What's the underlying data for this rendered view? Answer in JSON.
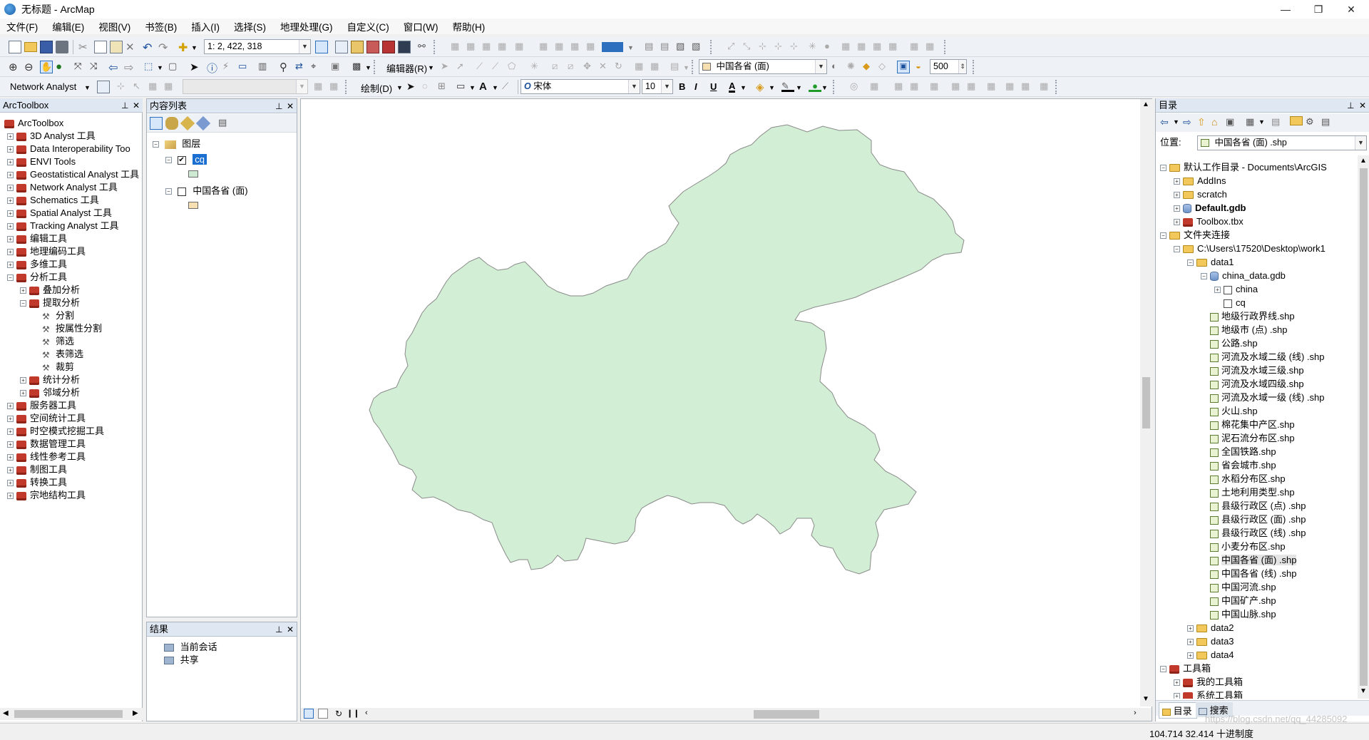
{
  "window": {
    "title": "无标题 - ArcMap",
    "min": "—",
    "restore": "❐",
    "close": "✕"
  },
  "menu": [
    "文件(F)",
    "编辑(E)",
    "视图(V)",
    "书签(B)",
    "插入(I)",
    "选择(S)",
    "地理处理(G)",
    "自定义(C)",
    "窗口(W)",
    "帮助(H)"
  ],
  "toolbar1": {
    "scale": "1: 2, 422, 318"
  },
  "toolbar2": {
    "editor_label": "编辑器(R)",
    "layer_combo": "中国各省 (面)",
    "ref_value": "500"
  },
  "toolbar3": {
    "network_analyst": "Network Analyst",
    "draw_label": "绘制(D)",
    "font_name": "宋体",
    "font_size": "10",
    "bold": "B",
    "italic": "I",
    "underline": "U",
    "font_color": "A"
  },
  "arctoolbox": {
    "title": "ArcToolbox",
    "root": "ArcToolbox",
    "items": [
      {
        "label": "3D Analyst 工具",
        "level": 0,
        "exp": "+"
      },
      {
        "label": "Data Interoperability Too",
        "level": 0,
        "exp": "+"
      },
      {
        "label": "ENVI Tools",
        "level": 0,
        "exp": "+"
      },
      {
        "label": "Geostatistical Analyst 工具",
        "level": 0,
        "exp": "+"
      },
      {
        "label": "Network Analyst 工具",
        "level": 0,
        "exp": "+"
      },
      {
        "label": "Schematics 工具",
        "level": 0,
        "exp": "+"
      },
      {
        "label": "Spatial Analyst 工具",
        "level": 0,
        "exp": "+"
      },
      {
        "label": "Tracking Analyst 工具",
        "level": 0,
        "exp": "+"
      },
      {
        "label": "编辑工具",
        "level": 0,
        "exp": "+"
      },
      {
        "label": "地理编码工具",
        "level": 0,
        "exp": "+"
      },
      {
        "label": "多维工具",
        "level": 0,
        "exp": "+"
      },
      {
        "label": "分析工具",
        "level": 0,
        "exp": "−"
      },
      {
        "label": "叠加分析",
        "level": 1,
        "exp": "+"
      },
      {
        "label": "提取分析",
        "level": 1,
        "exp": "−"
      },
      {
        "label": "分割",
        "level": 2,
        "exp": "",
        "tool": true
      },
      {
        "label": "按属性分割",
        "level": 2,
        "exp": "",
        "tool": true
      },
      {
        "label": "筛选",
        "level": 2,
        "exp": "",
        "tool": true
      },
      {
        "label": "表筛选",
        "level": 2,
        "exp": "",
        "tool": true
      },
      {
        "label": "裁剪",
        "level": 2,
        "exp": "",
        "tool": true
      },
      {
        "label": "统计分析",
        "level": 1,
        "exp": "+"
      },
      {
        "label": "邻域分析",
        "level": 1,
        "exp": "+"
      },
      {
        "label": "服务器工具",
        "level": 0,
        "exp": "+"
      },
      {
        "label": "空间统计工具",
        "level": 0,
        "exp": "+"
      },
      {
        "label": "时空模式挖掘工具",
        "level": 0,
        "exp": "+"
      },
      {
        "label": "数据管理工具",
        "level": 0,
        "exp": "+"
      },
      {
        "label": "线性参考工具",
        "level": 0,
        "exp": "+"
      },
      {
        "label": "制图工具",
        "level": 0,
        "exp": "+"
      },
      {
        "label": "转换工具",
        "level": 0,
        "exp": "+"
      },
      {
        "label": "宗地结构工具",
        "level": 0,
        "exp": "+"
      }
    ]
  },
  "toc": {
    "title": "内容列表",
    "layers_label": "图层",
    "layer1": "cq",
    "layer2": "中国各省 (面)",
    "layer1_color": "#cfead3",
    "layer2_color": "#f6dfb0"
  },
  "results": {
    "title": "结果",
    "items": [
      "当前会话",
      "共享"
    ]
  },
  "map": {
    "fill": "#d2efd5",
    "stroke": "#8a8a8a"
  },
  "catalog": {
    "title": "目录",
    "location_label": "位置:",
    "location_value": "中国各省 (面) .shp",
    "items": [
      {
        "label": "默认工作目录 - Documents\\ArcGIS",
        "level": 0,
        "exp": "−",
        "icon": "home"
      },
      {
        "label": "AddIns",
        "level": 1,
        "exp": "+",
        "icon": "folder"
      },
      {
        "label": "scratch",
        "level": 1,
        "exp": "+",
        "icon": "folder"
      },
      {
        "label": "Default.gdb",
        "level": 1,
        "exp": "+",
        "icon": "gdb",
        "bold": true
      },
      {
        "label": "Toolbox.tbx",
        "level": 1,
        "exp": "+",
        "icon": "tbx"
      },
      {
        "label": "文件夹连接",
        "level": 0,
        "exp": "−",
        "icon": "folder"
      },
      {
        "label": "C:\\Users\\17520\\Desktop\\work1",
        "level": 1,
        "exp": "−",
        "icon": "folder"
      },
      {
        "label": "data1",
        "level": 2,
        "exp": "−",
        "icon": "folder"
      },
      {
        "label": "china_data.gdb",
        "level": 3,
        "exp": "−",
        "icon": "gdb"
      },
      {
        "label": "china",
        "level": 4,
        "exp": "+",
        "icon": "fc"
      },
      {
        "label": "cq",
        "level": 4,
        "exp": "",
        "icon": "fc"
      },
      {
        "label": "地级行政界线.shp",
        "level": 3,
        "exp": "",
        "icon": "shp"
      },
      {
        "label": "地级市 (点) .shp",
        "level": 3,
        "exp": "",
        "icon": "shp"
      },
      {
        "label": "公路.shp",
        "level": 3,
        "exp": "",
        "icon": "shp"
      },
      {
        "label": "河流及水域二级 (线) .shp",
        "level": 3,
        "exp": "",
        "icon": "shp"
      },
      {
        "label": "河流及水域三级.shp",
        "level": 3,
        "exp": "",
        "icon": "shp"
      },
      {
        "label": "河流及水域四级.shp",
        "level": 3,
        "exp": "",
        "icon": "shp"
      },
      {
        "label": "河流及水域一级 (线) .shp",
        "level": 3,
        "exp": "",
        "icon": "shp"
      },
      {
        "label": "火山.shp",
        "level": 3,
        "exp": "",
        "icon": "shp"
      },
      {
        "label": "棉花集中产区.shp",
        "level": 3,
        "exp": "",
        "icon": "shp"
      },
      {
        "label": "泥石流分布区.shp",
        "level": 3,
        "exp": "",
        "icon": "shp"
      },
      {
        "label": "全国铁路.shp",
        "level": 3,
        "exp": "",
        "icon": "shp"
      },
      {
        "label": "省会城市.shp",
        "level": 3,
        "exp": "",
        "icon": "shp"
      },
      {
        "label": "水稻分布区.shp",
        "level": 3,
        "exp": "",
        "icon": "shp"
      },
      {
        "label": "土地利用类型.shp",
        "level": 3,
        "exp": "",
        "icon": "shp"
      },
      {
        "label": "县级行政区 (点) .shp",
        "level": 3,
        "exp": "",
        "icon": "shp"
      },
      {
        "label": "县级行政区 (面) .shp",
        "level": 3,
        "exp": "",
        "icon": "shp"
      },
      {
        "label": "县级行政区 (线) .shp",
        "level": 3,
        "exp": "",
        "icon": "shp"
      },
      {
        "label": "小麦分布区.shp",
        "level": 3,
        "exp": "",
        "icon": "shp"
      },
      {
        "label": "中国各省 (面) .shp",
        "level": 3,
        "exp": "",
        "icon": "shp",
        "selected": true
      },
      {
        "label": "中国各省 (线) .shp",
        "level": 3,
        "exp": "",
        "icon": "shp"
      },
      {
        "label": "中国河流.shp",
        "level": 3,
        "exp": "",
        "icon": "shp"
      },
      {
        "label": "中国矿产.shp",
        "level": 3,
        "exp": "",
        "icon": "shp"
      },
      {
        "label": "中国山脉.shp",
        "level": 3,
        "exp": "",
        "icon": "shp"
      },
      {
        "label": "data2",
        "level": 2,
        "exp": "+",
        "icon": "folder"
      },
      {
        "label": "data3",
        "level": 2,
        "exp": "+",
        "icon": "folder"
      },
      {
        "label": "data4",
        "level": 2,
        "exp": "+",
        "icon": "folder"
      },
      {
        "label": "工具箱",
        "level": 0,
        "exp": "−",
        "icon": "tbx"
      },
      {
        "label": "我的工具箱",
        "level": 1,
        "exp": "+",
        "icon": "tbx"
      },
      {
        "label": "系统工具箱",
        "level": 1,
        "exp": "+",
        "icon": "tbx"
      }
    ],
    "tab_catalog": "目录",
    "tab_search": "搜索"
  },
  "status": {
    "coords": "104.714  32.414 十进制度",
    "watermark": "https://blog.csdn.net/qq_44285092"
  }
}
